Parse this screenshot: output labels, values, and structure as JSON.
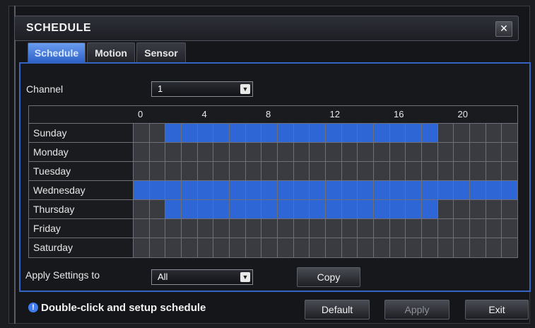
{
  "window": {
    "title": "SCHEDULE",
    "close_glyph": "✕"
  },
  "tabs": [
    {
      "label": "Schedule",
      "active": true
    },
    {
      "label": "Motion",
      "active": false
    },
    {
      "label": "Sensor",
      "active": false
    }
  ],
  "channel": {
    "label": "Channel",
    "value": "1"
  },
  "schedule": {
    "hour_labels": [
      "0",
      "4",
      "8",
      "12",
      "16",
      "20"
    ],
    "days": [
      {
        "name": "Sunday",
        "active_hours": [
          2,
          3,
          4,
          5,
          6,
          7,
          8,
          9,
          10,
          11,
          12,
          13,
          14,
          15,
          16,
          17,
          18
        ]
      },
      {
        "name": "Monday",
        "active_hours": []
      },
      {
        "name": "Tuesday",
        "active_hours": []
      },
      {
        "name": "Wednesday",
        "active_hours": [
          0,
          1,
          2,
          3,
          4,
          5,
          6,
          7,
          8,
          9,
          10,
          11,
          12,
          13,
          14,
          15,
          16,
          17,
          18,
          19,
          20,
          21,
          22,
          23
        ]
      },
      {
        "name": "Thursday",
        "active_hours": [
          2,
          3,
          4,
          5,
          6,
          7,
          8,
          9,
          10,
          11,
          12,
          13,
          14,
          15,
          16,
          17,
          18
        ]
      },
      {
        "name": "Friday",
        "active_hours": []
      },
      {
        "name": "Saturday",
        "active_hours": []
      }
    ],
    "colors": {
      "on": "#2f66d6",
      "off": "#3a3b40"
    }
  },
  "apply": {
    "label": "Apply Settings to",
    "value": "All"
  },
  "buttons": {
    "copy": "Copy",
    "default": "Default",
    "apply": "Apply",
    "exit": "Exit"
  },
  "hint": "Double-click and setup schedule",
  "icons": {
    "info": "info-icon",
    "dropdown": "chevron-down-icon",
    "close": "close-icon"
  }
}
